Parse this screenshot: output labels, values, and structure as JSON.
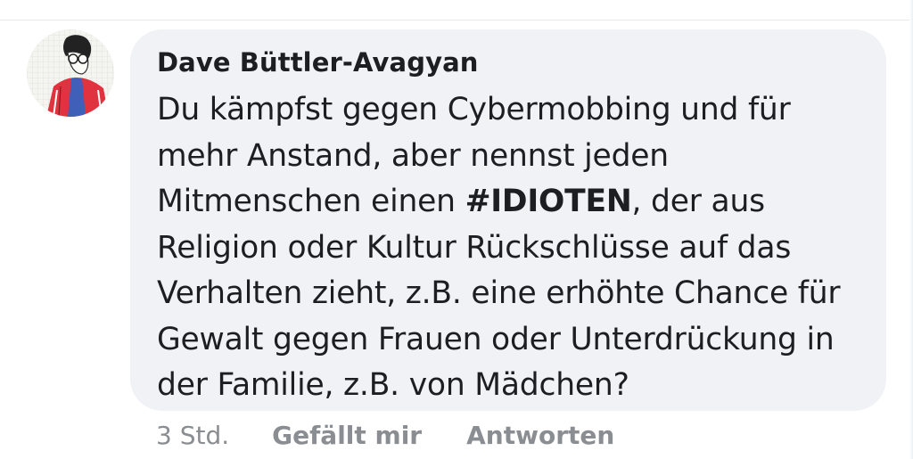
{
  "comment": {
    "author": "Dave Büttler-Avagyan",
    "text_lines": [
      "Du kämpfst gegen Cybermobbing und für",
      "mehr Anstand, aber nennst jeden",
      "Mitmenschen einen ",
      "#IDIOTEN",
      ", der aus",
      "Religion oder Kultur Rückschlüsse auf das",
      "Verhalten zieht, z.B. eine erhöhte Chance für",
      "Gewalt gegen Frauen oder Unterdrückung in",
      "der Familie, z.B. von Mädchen?"
    ],
    "timestamp": "3 Std.",
    "like_label": "Gefällt mir",
    "reply_label": "Antworten"
  },
  "colors": {
    "bubble_background": "#f0f2f5",
    "text": "#1c1e21",
    "meta_text": "#8a8d91"
  },
  "icons": {
    "avatar": "cartoon-person-with-glasses-avatar"
  }
}
